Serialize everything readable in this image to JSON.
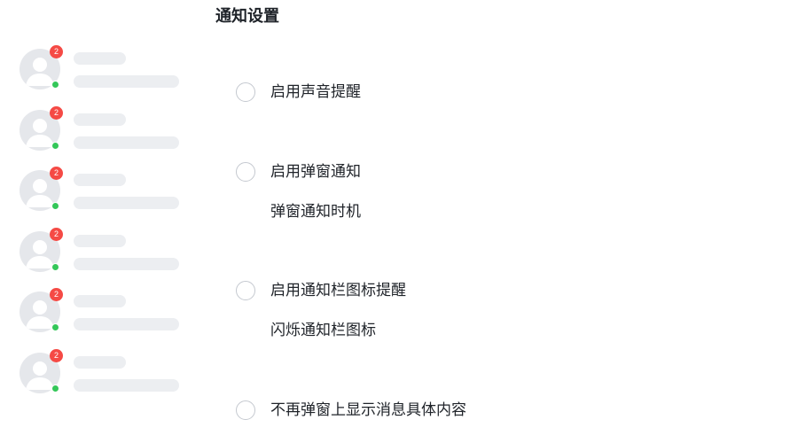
{
  "chat_list": {
    "items": [
      {
        "unread": "2"
      },
      {
        "unread": "2"
      },
      {
        "unread": "2"
      },
      {
        "unread": "2"
      },
      {
        "unread": "2"
      },
      {
        "unread": "2"
      }
    ]
  },
  "settings": {
    "title": "通知设置",
    "options": [
      {
        "label": "启用声音提醒"
      },
      {
        "label": "启用弹窗通知",
        "sub_label": "弹窗通知时机"
      },
      {
        "label": "启用通知栏图标提醒",
        "sub_label": "闪烁通知栏图标"
      },
      {
        "label": "不再弹窗上显示消息具体内容"
      }
    ]
  },
  "colors": {
    "badge": "#f54a45",
    "online": "#34c759",
    "skeleton": "#eceef1",
    "avatar_bg": "#e5e7eb"
  }
}
